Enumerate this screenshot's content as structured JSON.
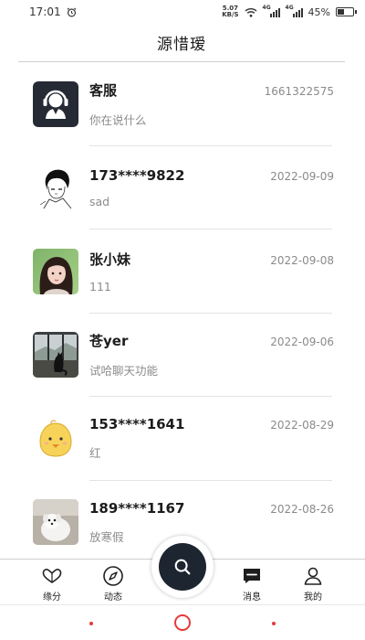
{
  "status_bar": {
    "time": "17:01",
    "net_speed_value": "5.07",
    "net_speed_unit": "KB/S",
    "signal1_label": "4G",
    "signal2_label": "4G",
    "battery": "45%",
    "battery_level": 0.45
  },
  "header": {
    "title": "源惜瑷"
  },
  "chats": [
    {
      "name": "客服",
      "time": "1661322575",
      "message": "你在说什么",
      "avatar": "support-agent-avatar"
    },
    {
      "name": "173****9822",
      "time": "2022-09-09",
      "message": "sad",
      "avatar": "sketch-boy-avatar"
    },
    {
      "name": "张小妹",
      "time": "2022-09-08",
      "message": "111",
      "avatar": "girl-photo-avatar"
    },
    {
      "name": "苍yer",
      "time": "2022-09-06",
      "message": "试哈聊天功能",
      "avatar": "cat-window-avatar"
    },
    {
      "name": "153****1641",
      "time": "2022-08-29",
      "message": "红",
      "avatar": "chick-avatar"
    },
    {
      "name": "189****1167",
      "time": "2022-08-26",
      "message": "放寒假",
      "avatar": "white-dog-avatar"
    }
  ],
  "tabs": [
    {
      "label": "缘分",
      "icon": "hearts-icon"
    },
    {
      "label": "动态",
      "icon": "compass-icon"
    },
    {
      "label": "消息",
      "icon": "message-icon"
    },
    {
      "label": "我的",
      "icon": "person-icon"
    }
  ],
  "fab": {
    "icon": "search-icon"
  },
  "colors": {
    "fab": "#1d2530",
    "nav_accent": "#e63a3a",
    "divider": "#cfcfcf"
  }
}
